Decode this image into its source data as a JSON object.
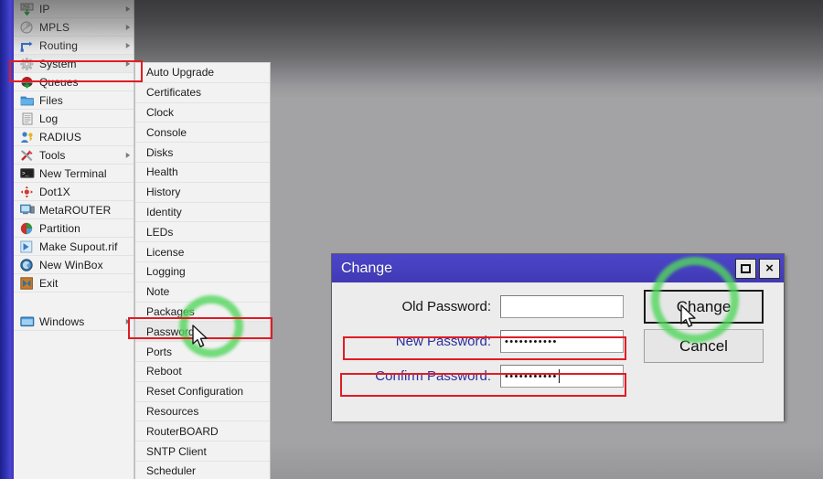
{
  "desktop": {
    "background_color": "#a3a2a4"
  },
  "main_menu": {
    "items": [
      {
        "label": "IP",
        "icon": "ip-icon",
        "submenu": true
      },
      {
        "label": "MPLS",
        "icon": "mpls-icon",
        "submenu": true
      },
      {
        "label": "Routing",
        "icon": "routing-icon",
        "submenu": true
      },
      {
        "label": "System",
        "icon": "system-gear-icon",
        "submenu": true
      },
      {
        "label": "Queues",
        "icon": "queues-icon",
        "submenu": false
      },
      {
        "label": "Files",
        "icon": "folder-icon",
        "submenu": false
      },
      {
        "label": "Log",
        "icon": "log-icon",
        "submenu": false
      },
      {
        "label": "RADIUS",
        "icon": "radius-user-key-icon",
        "submenu": false
      },
      {
        "label": "Tools",
        "icon": "tools-icon",
        "submenu": true
      },
      {
        "label": "New Terminal",
        "icon": "terminal-icon",
        "submenu": false
      },
      {
        "label": "Dot1X",
        "icon": "dot1x-icon",
        "submenu": false
      },
      {
        "label": "MetaROUTER",
        "icon": "metarouter-icon",
        "submenu": false
      },
      {
        "label": "Partition",
        "icon": "partition-pie-icon",
        "submenu": false
      },
      {
        "label": "Make Supout.rif",
        "icon": "make-supout-icon",
        "submenu": false
      },
      {
        "label": "New WinBox",
        "icon": "new-winbox-icon",
        "submenu": false
      },
      {
        "label": "Exit",
        "icon": "exit-icon",
        "submenu": false
      },
      {
        "label": "",
        "icon": "",
        "submenu": false
      },
      {
        "label": "Windows",
        "icon": "windows-icon",
        "submenu": true
      }
    ],
    "selected": "System"
  },
  "sub_menu": {
    "parent": "System",
    "items": [
      {
        "label": "Auto Upgrade"
      },
      {
        "label": "Certificates"
      },
      {
        "label": "Clock"
      },
      {
        "label": "Console"
      },
      {
        "label": "Disks"
      },
      {
        "label": "Health"
      },
      {
        "label": "History"
      },
      {
        "label": "Identity"
      },
      {
        "label": "LEDs"
      },
      {
        "label": "License"
      },
      {
        "label": "Logging"
      },
      {
        "label": "Note"
      },
      {
        "label": "Packages"
      },
      {
        "label": "Password"
      },
      {
        "label": "Ports"
      },
      {
        "label": "Reboot"
      },
      {
        "label": "Reset Configuration"
      },
      {
        "label": "Resources"
      },
      {
        "label": "RouterBOARD"
      },
      {
        "label": "SNTP Client"
      },
      {
        "label": "Scheduler"
      }
    ],
    "highlighted": "Password"
  },
  "dialog": {
    "title": "Change",
    "window_buttons": {
      "maximize": "maximize-restore",
      "close": "×"
    },
    "fields": [
      {
        "label": "Old Password:",
        "value": "",
        "label_color": "#111111"
      },
      {
        "label": "New Password:",
        "value": "•••••••••••",
        "label_color": "#2b2f9e"
      },
      {
        "label": "Confirm Password:",
        "value": "•••••••••••",
        "label_color": "#2b2f9e"
      }
    ],
    "buttons": [
      {
        "label": "Change",
        "default": true
      },
      {
        "label": "Cancel",
        "default": false
      }
    ],
    "titlebar_color": "#4640bf"
  },
  "annotations": {
    "highlight_color": "#e01c24",
    "marker_color": "#52d65c",
    "red_boxes": [
      "System",
      "Password",
      "New Password:",
      "Confirm Password:"
    ],
    "green_circles": [
      "Password",
      "Change"
    ]
  }
}
